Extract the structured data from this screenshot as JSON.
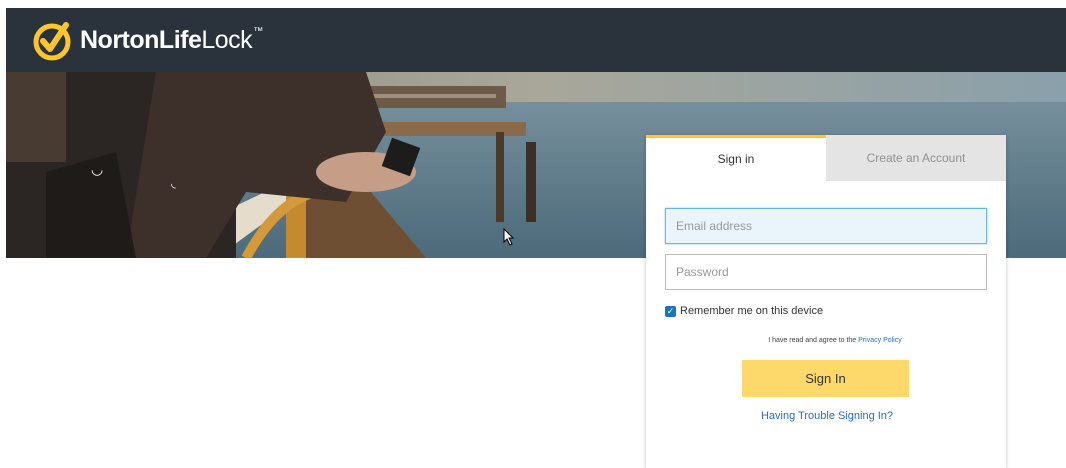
{
  "header": {
    "logo_bold": "NortonLife",
    "logo_light": "Lock",
    "logo_tm": "™"
  },
  "signin": {
    "tabs": [
      {
        "label": "Sign in",
        "active": true
      },
      {
        "label": "Create an Account",
        "active": false
      }
    ],
    "email_placeholder": "Email address",
    "password_placeholder": "Password",
    "remember_label": "Remember me on this device",
    "remember_checked": true,
    "agree_text": "I have read and agree to the",
    "privacy_link": "Privacy Policy",
    "signin_button": "Sign In",
    "trouble_link": "Having Trouble Signing In?"
  },
  "colors": {
    "topbar": "#2a333c",
    "brand_yellow": "#ffc72c",
    "button_yellow": "#fdd96b",
    "link_blue": "#2b6fb6"
  }
}
